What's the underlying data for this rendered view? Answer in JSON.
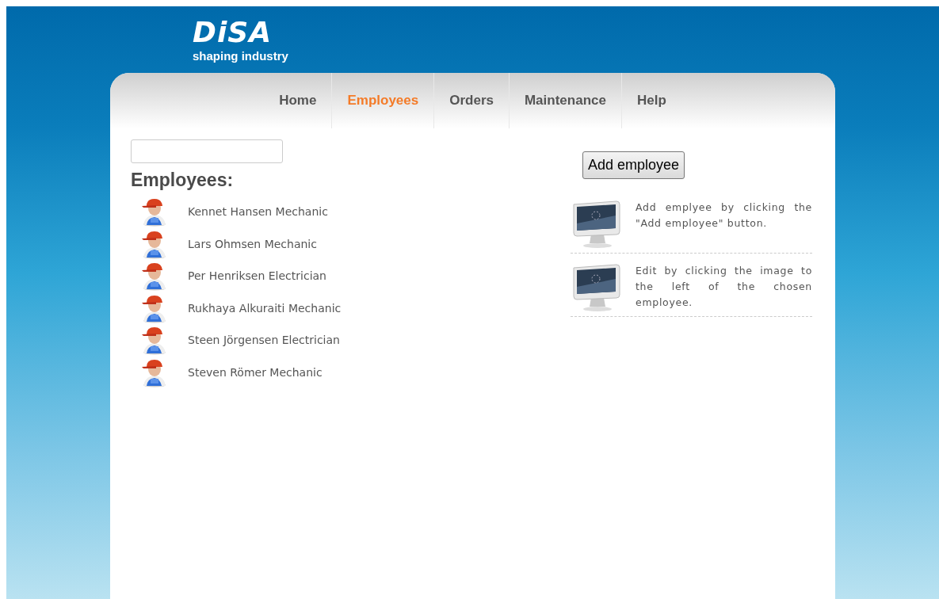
{
  "logo": {
    "brand": "DiSA",
    "tagline": "shaping industry"
  },
  "nav": [
    {
      "label": "Home",
      "selected": false
    },
    {
      "label": "Employees",
      "selected": true
    },
    {
      "label": "Orders",
      "selected": false
    },
    {
      "label": "Maintenance",
      "selected": false
    },
    {
      "label": "Help",
      "selected": false
    }
  ],
  "heading": "Employees:",
  "employees": [
    {
      "name": "Kennet Hansen Mechanic"
    },
    {
      "name": "Lars Ohmsen Mechanic"
    },
    {
      "name": "Per Henriksen Electrician"
    },
    {
      "name": "Rukhaya Alkuraiti Mechanic"
    },
    {
      "name": "Steen Jörgensen Electrician"
    },
    {
      "name": "Steven Römer Mechanic"
    }
  ],
  "add_button": "Add employee",
  "tips": [
    {
      "text": "Add emplyee by clicking the \"Add employee\" button."
    },
    {
      "text": "Edit by clicking the image to the left of the chosen employee."
    }
  ]
}
